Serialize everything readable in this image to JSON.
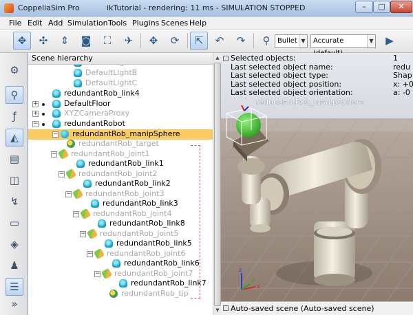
{
  "window": {
    "app_title": "CoppeliaSim Pro",
    "scene_title": "ikTutorial - rendering: 11 ms - SIMULATION STOPPED",
    "minimize": "–",
    "maximize": "□",
    "close": "✕"
  },
  "menu": [
    "File",
    "Edit",
    "Add",
    "Simulation",
    "Tools",
    "Plugins",
    "Scenes",
    "Help"
  ],
  "toolbar": {
    "engine": "Bullet",
    "accuracy": "Accurate (default)"
  },
  "hierarchy": {
    "title": "Scene hierarchy",
    "items": [
      {
        "label": "DefaultLightA",
        "icon": "light-icon",
        "gray": true
      },
      {
        "label": "DefaultLightB",
        "icon": "light-icon",
        "gray": true
      },
      {
        "label": "DefaultLightC",
        "icon": "light-icon",
        "gray": true
      },
      {
        "label": "redundantRob_link4",
        "icon": "shape-icon",
        "gray": false
      },
      {
        "label": "DefaultFloor",
        "icon": "shape-icon",
        "gray": false
      },
      {
        "label": "XYZCameraProxy",
        "icon": "shape-icon",
        "gray": true
      },
      {
        "label": "redundantRobot",
        "icon": "shape-icon",
        "gray": false
      },
      {
        "label": "redundantRob_manipSphere",
        "icon": "sphere-icon",
        "gray": false
      },
      {
        "label": "redundantRob_target",
        "icon": "dummy-icon",
        "gray": true
      },
      {
        "label": "redundantRob_joint1",
        "icon": "joint-icon",
        "gray": true
      },
      {
        "label": "redundantRob_link1",
        "icon": "shape-icon",
        "gray": false
      },
      {
        "label": "redundantRob_joint2",
        "icon": "joint-icon",
        "gray": true
      },
      {
        "label": "redundantRob_link2",
        "icon": "shape-icon",
        "gray": false
      },
      {
        "label": "redundantRob_joint3",
        "icon": "joint-icon",
        "gray": true
      },
      {
        "label": "redundantRob_link3",
        "icon": "shape-icon",
        "gray": false
      },
      {
        "label": "redundantRob_joint4",
        "icon": "joint-icon",
        "gray": true
      },
      {
        "label": "redundantRob_link8",
        "icon": "shape-icon",
        "gray": false
      },
      {
        "label": "redundantRob_joint5",
        "icon": "joint-icon",
        "gray": true
      },
      {
        "label": "redundantRob_link5",
        "icon": "shape-icon",
        "gray": false
      },
      {
        "label": "redundantRob_joint6",
        "icon": "joint-icon",
        "gray": true
      },
      {
        "label": "redundantRob_link6",
        "icon": "shape-icon",
        "gray": false
      },
      {
        "label": "redundantRob_joint7",
        "icon": "joint-icon",
        "gray": true
      },
      {
        "label": "redundantRob_link7",
        "icon": "shape-icon",
        "gray": false
      },
      {
        "label": "redundantRob_tip",
        "icon": "dummy-icon",
        "gray": true
      }
    ]
  },
  "info": {
    "labels": [
      "Selected objects:",
      "Last selected object name:",
      "Last selected object type:",
      "Last selected object position:",
      "Last selected object orientation:"
    ],
    "values": [
      "1",
      "redu",
      "Shap",
      "x: +0",
      "a: -0"
    ]
  },
  "viewport": {
    "object_label": "redundantRob_manipSphere"
  },
  "status": {
    "text": "Auto-saved scene (Auto-saved scene)"
  }
}
